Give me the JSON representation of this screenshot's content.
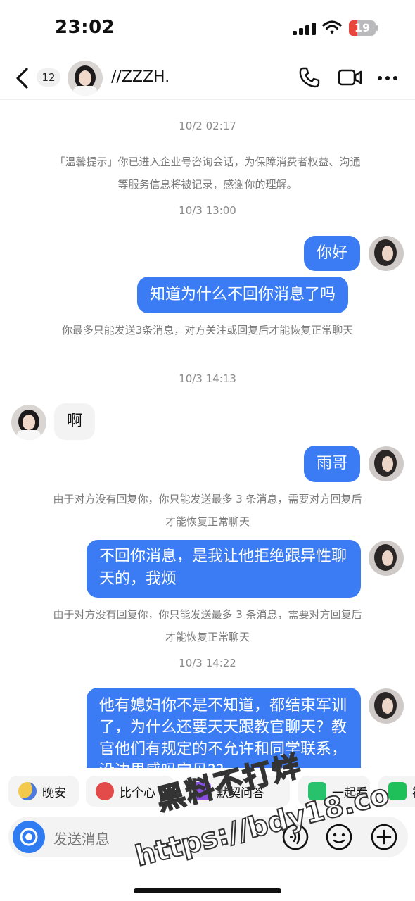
{
  "status_bar": {
    "time": "23:02",
    "battery": "19"
  },
  "header": {
    "unread_count": "12",
    "contact_name": "//ZZZH."
  },
  "messages": {
    "ts1": "10/2 02:17",
    "notice": "「温馨提示」你已进入企业号咨询会话，为保障消费者权益、沟通等服务信息将被记录，感谢你的理解。",
    "ts2": "10/3 13:00",
    "m1": "你好",
    "m2": "知道为什么不回你消息了吗",
    "sys1": "你最多只能发送3条消息，对方关注或回复后才能恢复正常聊天",
    "ts3": "10/3 14:13",
    "m3": "啊",
    "m4": "雨哥",
    "sys2": "由于对方没有回复你，你只能发送最多 3 条消息，需要对方回复后才能恢复正常聊天",
    "m5": "不回你消息，是我让他拒绝跟异性聊天的，我烦",
    "sys3": "由于对方没有回复你，你只能发送最多 3 条消息，需要对方回复后才能恢复正常聊天",
    "ts4": "10/3 14:22",
    "m6": "他有媳妇你不是不知道，都结束军训了，为什么还要天天跟教官聊天？教官他们有规定的不允许和同学联系，没边界感吗宝贝??"
  },
  "quick_actions": [
    "晚安",
    "比个心",
    "默契问答",
    "一起看",
    "视频"
  ],
  "input": {
    "placeholder": "发送消息"
  },
  "watermark": {
    "line1": "黑料不打烊",
    "line2": "https://bdy18.co"
  },
  "colors": {
    "accent": "#3b7cf5",
    "incoming_bubble": "#f3f3f3",
    "system_text": "#7a7a7a"
  }
}
